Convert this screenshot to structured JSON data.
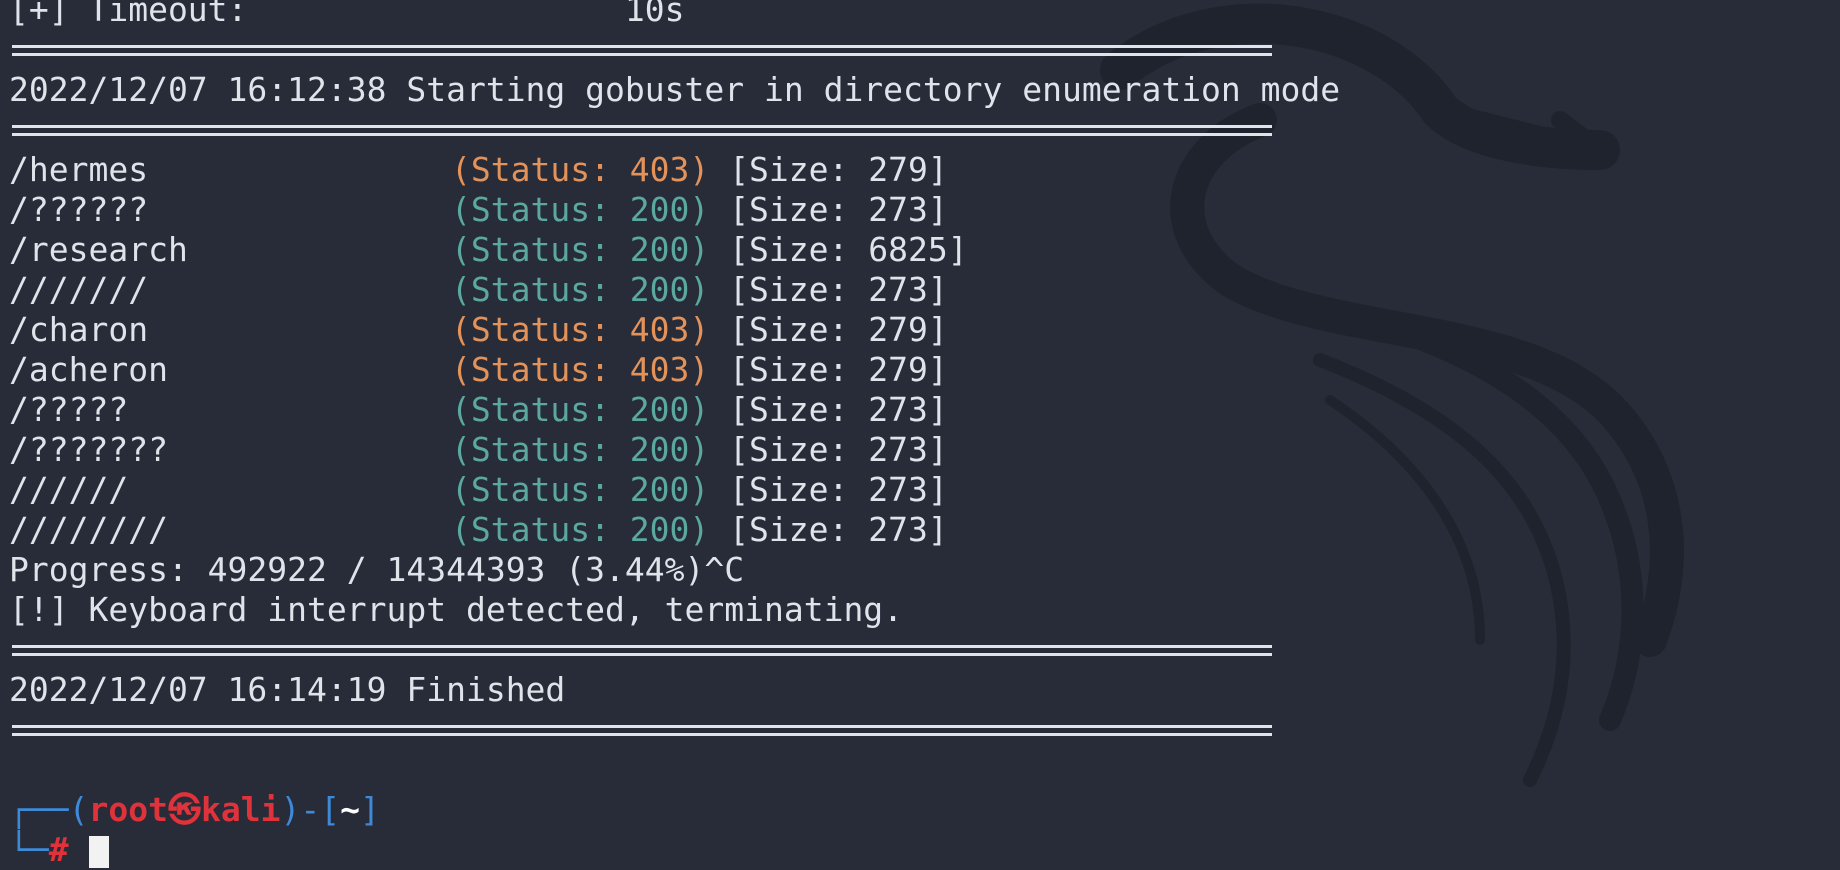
{
  "header": {
    "timeout_line": "[+] Timeout:                   10s"
  },
  "start_line": "2022/12/07 16:12:38 Starting gobuster in directory enumeration mode",
  "results": [
    {
      "path": "/hermes",
      "status": "(Status: 403)",
      "size": "[Size: 279]"
    },
    {
      "path": "/??????",
      "status": "(Status: 200)",
      "size": "[Size: 273]"
    },
    {
      "path": "/research",
      "status": "(Status: 200)",
      "size": "[Size: 6825]"
    },
    {
      "path": "///////",
      "status": "(Status: 200)",
      "size": "[Size: 273]"
    },
    {
      "path": "/charon",
      "status": "(Status: 403)",
      "size": "[Size: 279]"
    },
    {
      "path": "/acheron",
      "status": "(Status: 403)",
      "size": "[Size: 279]"
    },
    {
      "path": "/?????",
      "status": "(Status: 200)",
      "size": "[Size: 273]"
    },
    {
      "path": "/???????",
      "status": "(Status: 200)",
      "size": "[Size: 273]"
    },
    {
      "path": "//////",
      "status": "(Status: 200)",
      "size": "[Size: 273]"
    },
    {
      "path": "////////",
      "status": "(Status: 200)",
      "size": "[Size: 273]"
    }
  ],
  "progress_line": "Progress: 492922 / 14344393 (3.44%)^C",
  "interrupt_line": "[!] Keyboard interrupt detected, terminating.",
  "finished_line": "2022/12/07 16:14:19 Finished",
  "prompt": {
    "open": "┌──(",
    "user": "root",
    "at_symbol": "㉿",
    "host": "kali",
    "mid": ")-[",
    "dir": "~",
    "close": "]",
    "corner": "└─",
    "hash": "#"
  },
  "colors": {
    "background": "#272c38",
    "text": "#dfe3ea",
    "status_403": "#e3935a",
    "status_200": "#5ba89f",
    "prompt_blue": "#3e8ad9",
    "prompt_red": "#e0323a"
  }
}
